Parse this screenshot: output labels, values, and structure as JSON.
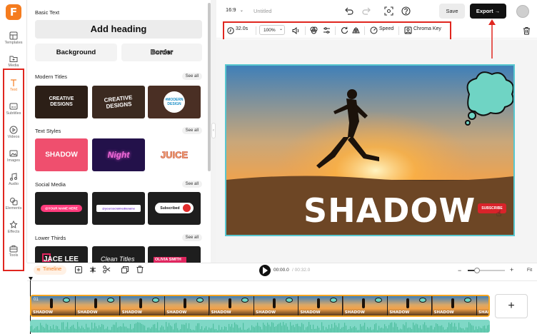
{
  "app": {
    "logo_letter": "F"
  },
  "rail": [
    {
      "label": "Templates",
      "icon": "templates-icon"
    },
    {
      "label": "Media",
      "icon": "media-icon"
    },
    {
      "label": "Text",
      "icon": "text-icon"
    },
    {
      "label": "Subtitles",
      "icon": "subtitles-icon"
    },
    {
      "label": "Videos",
      "icon": "videos-icon"
    },
    {
      "label": "Images",
      "icon": "images-icon"
    },
    {
      "label": "Audio",
      "icon": "audio-icon"
    },
    {
      "label": "Elements",
      "icon": "elements-icon"
    },
    {
      "label": "Effects",
      "icon": "effects-icon"
    },
    {
      "label": "Tools",
      "icon": "tools-icon"
    }
  ],
  "panel": {
    "basic_text_title": "Basic Text",
    "add_heading": "Add heading",
    "background": "Background",
    "border": "Border",
    "see_all": "See all",
    "modern_titles": "Modern Titles",
    "modern_titles_items": [
      {
        "line1": "CREATIVE",
        "line2": "DESIGNS"
      },
      {
        "line1": "CREATIVE",
        "line2": "DESIGNS"
      },
      {
        "line1": "#MODERN",
        "line2": "DESIGN"
      }
    ],
    "text_styles": "Text Styles",
    "text_styles_items": [
      "SHADOW",
      "Night",
      "JUICE"
    ],
    "social_media": "Social Media",
    "social_media_items": [
      "@YOUR NAME HERE",
      "@yoursocialmedianame",
      "Subscribed"
    ],
    "lower_thirds": "Lower Thirds",
    "lower_thirds_items": [
      "JACE LEE",
      "Clean Titles",
      "OLIVIA SMITH"
    ]
  },
  "topbar": {
    "ratio": "16:9",
    "project_title": "Untitled",
    "save": "Save",
    "export": "Export"
  },
  "toolbar": {
    "duration": "32.0s",
    "zoom": "100%",
    "speed": "Speed",
    "chroma_key": "Chroma Key"
  },
  "canvas": {
    "text": "SHADOW",
    "subscribe": "SUBSCRIBE"
  },
  "timeline": {
    "label": "Timeline",
    "current_time": "00:00.0",
    "total_time": "/ 00:32.0",
    "fit": "Fit",
    "clip_index": "01",
    "frame_text": "SHADOW",
    "zoom_level": 0.25
  },
  "colors": {
    "accent": "#f57c1f",
    "annotation": "#e0261f",
    "selection": "#57c7cf",
    "audio": "#7fd8c6"
  }
}
